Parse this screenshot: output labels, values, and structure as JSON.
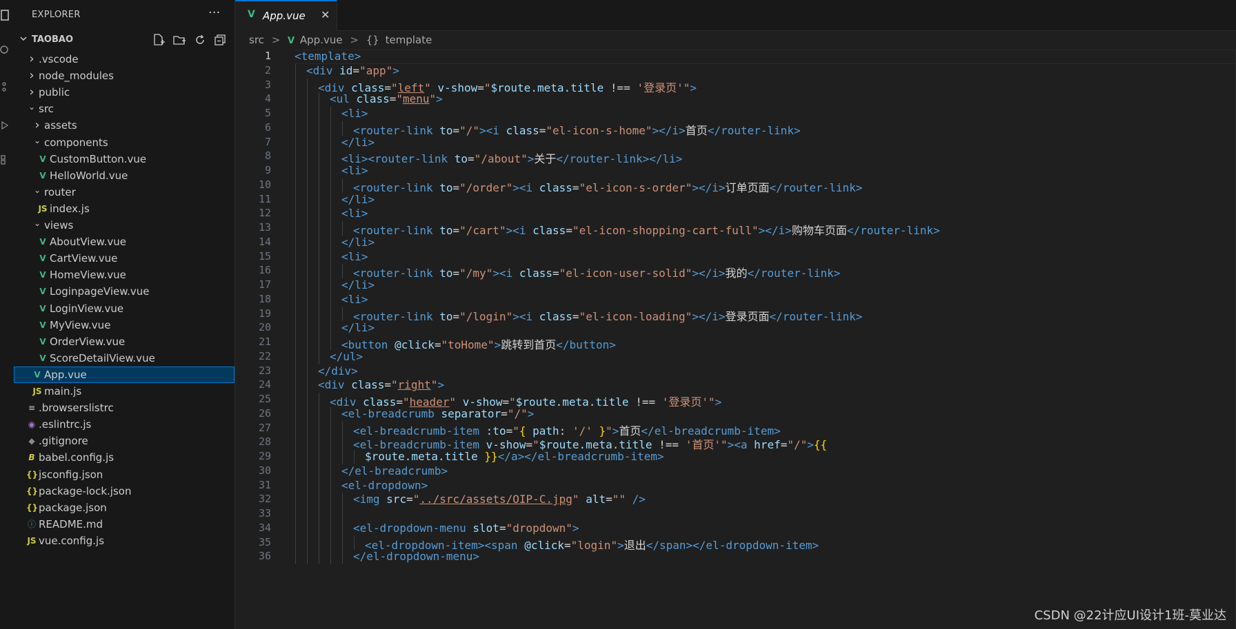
{
  "explorer": {
    "title": "EXPLORER",
    "more": "···",
    "root": "TAOBAO",
    "items": [
      {
        "label": ".vscode",
        "icon": "chevron-right",
        "depth": 1
      },
      {
        "label": "node_modules",
        "icon": "chevron-right",
        "depth": 1
      },
      {
        "label": "public",
        "icon": "chevron-right",
        "depth": 1
      },
      {
        "label": "src",
        "icon": "chevron-down",
        "depth": 1
      },
      {
        "label": "assets",
        "icon": "chevron-right",
        "depth": 2
      },
      {
        "label": "components",
        "icon": "chevron-down",
        "depth": 2
      },
      {
        "label": "CustomButton.vue",
        "icon": "vue",
        "depth": 3
      },
      {
        "label": "HelloWorld.vue",
        "icon": "vue",
        "depth": 3
      },
      {
        "label": "router",
        "icon": "chevron-down",
        "depth": 2
      },
      {
        "label": "index.js",
        "icon": "js",
        "depth": 3
      },
      {
        "label": "views",
        "icon": "chevron-down",
        "depth": 2
      },
      {
        "label": "AboutView.vue",
        "icon": "vue",
        "depth": 3
      },
      {
        "label": "CartView.vue",
        "icon": "vue",
        "depth": 3
      },
      {
        "label": "HomeView.vue",
        "icon": "vue",
        "depth": 3
      },
      {
        "label": "LoginpageView.vue",
        "icon": "vue",
        "depth": 3
      },
      {
        "label": "LoginView.vue",
        "icon": "vue",
        "depth": 3
      },
      {
        "label": "MyView.vue",
        "icon": "vue",
        "depth": 3
      },
      {
        "label": "OrderView.vue",
        "icon": "vue",
        "depth": 3
      },
      {
        "label": "ScoreDetailView.vue",
        "icon": "vue",
        "depth": 3
      },
      {
        "label": "App.vue",
        "icon": "vue",
        "depth": 2,
        "selected": true
      },
      {
        "label": "main.js",
        "icon": "js",
        "depth": 2
      },
      {
        "label": ".browserslistrc",
        "icon": "lines",
        "depth": 1
      },
      {
        "label": ".eslintrc.js",
        "icon": "eslint",
        "depth": 1
      },
      {
        "label": ".gitignore",
        "icon": "git",
        "depth": 1
      },
      {
        "label": "babel.config.js",
        "icon": "babel",
        "depth": 1
      },
      {
        "label": "jsconfig.json",
        "icon": "json",
        "depth": 1
      },
      {
        "label": "package-lock.json",
        "icon": "json",
        "depth": 1
      },
      {
        "label": "package.json",
        "icon": "json",
        "depth": 1
      },
      {
        "label": "README.md",
        "icon": "info",
        "depth": 1
      },
      {
        "label": "vue.config.js",
        "icon": "js",
        "depth": 1
      }
    ]
  },
  "tab": {
    "label": "App.vue",
    "close": "✕"
  },
  "breadcrumb": {
    "part1": "src",
    "sep": ">",
    "part2": "App.vue",
    "part3_icon": "{}",
    "part3": "template"
  },
  "active_line": 1,
  "code_lines": [
    [
      [
        "t",
        "<template>"
      ]
    ],
    [
      [
        "t",
        "<div"
      ],
      [
        "",
        " "
      ],
      [
        "a",
        "id"
      ],
      [
        "",
        "="
      ],
      [
        "s",
        "\"app\""
      ],
      [
        "t",
        ">"
      ]
    ],
    [
      [
        "t",
        "<div"
      ],
      [
        "",
        " "
      ],
      [
        "a",
        "class"
      ],
      [
        "",
        "="
      ],
      [
        "s",
        "\""
      ],
      [
        "su",
        "left"
      ],
      [
        "s",
        "\""
      ],
      [
        "",
        " "
      ],
      [
        "a",
        "v-show"
      ],
      [
        "",
        "="
      ],
      [
        "s",
        "\""
      ],
      [
        "a",
        "$route.meta.title"
      ],
      [
        "",
        " "
      ],
      [
        "",
        "!=="
      ],
      [
        "",
        " "
      ],
      [
        "s",
        "'登录页'"
      ],
      [
        "s",
        "\""
      ],
      [
        "t",
        ">"
      ]
    ],
    [
      [
        "t",
        "<ul"
      ],
      [
        "",
        " "
      ],
      [
        "a",
        "class"
      ],
      [
        "",
        "="
      ],
      [
        "s",
        "\""
      ],
      [
        "su",
        "menu"
      ],
      [
        "s",
        "\""
      ],
      [
        "t",
        ">"
      ]
    ],
    [
      [
        "t",
        "<li>"
      ]
    ],
    [
      [
        "t",
        "<router-link"
      ],
      [
        "",
        " "
      ],
      [
        "a",
        "to"
      ],
      [
        "",
        "="
      ],
      [
        "s",
        "\"/\""
      ],
      [
        "t",
        "><i"
      ],
      [
        "",
        " "
      ],
      [
        "a",
        "class"
      ],
      [
        "",
        "="
      ],
      [
        "s",
        "\"el-icon-s-home\""
      ],
      [
        "t",
        "></i>"
      ],
      [
        "",
        "首页"
      ],
      [
        "t",
        "</router-link>"
      ]
    ],
    [
      [
        "t",
        "</li>"
      ]
    ],
    [
      [
        "t",
        "<li><router-link"
      ],
      [
        "",
        " "
      ],
      [
        "a",
        "to"
      ],
      [
        "",
        "="
      ],
      [
        "s",
        "\"/about\""
      ],
      [
        "t",
        ">"
      ],
      [
        "",
        "关于"
      ],
      [
        "t",
        "</router-link></li>"
      ]
    ],
    [
      [
        "t",
        "<li>"
      ]
    ],
    [
      [
        "t",
        "<router-link"
      ],
      [
        "",
        " "
      ],
      [
        "a",
        "to"
      ],
      [
        "",
        "="
      ],
      [
        "s",
        "\"/order\""
      ],
      [
        "t",
        "><i"
      ],
      [
        "",
        " "
      ],
      [
        "a",
        "class"
      ],
      [
        "",
        "="
      ],
      [
        "s",
        "\"el-icon-s-order\""
      ],
      [
        "t",
        "></i>"
      ],
      [
        "",
        "订单页面"
      ],
      [
        "t",
        "</router-link>"
      ]
    ],
    [
      [
        "t",
        "</li>"
      ]
    ],
    [
      [
        "t",
        "<li>"
      ]
    ],
    [
      [
        "t",
        "<router-link"
      ],
      [
        "",
        " "
      ],
      [
        "a",
        "to"
      ],
      [
        "",
        "="
      ],
      [
        "s",
        "\"/cart\""
      ],
      [
        "t",
        "><i"
      ],
      [
        "",
        " "
      ],
      [
        "a",
        "class"
      ],
      [
        "",
        "="
      ],
      [
        "s",
        "\"el-icon-shopping-cart-full\""
      ],
      [
        "t",
        "></i>"
      ],
      [
        "",
        "购物车页面"
      ],
      [
        "t",
        "</router-link>"
      ]
    ],
    [
      [
        "t",
        "</li>"
      ]
    ],
    [
      [
        "t",
        "<li>"
      ]
    ],
    [
      [
        "t",
        "<router-link"
      ],
      [
        "",
        " "
      ],
      [
        "a",
        "to"
      ],
      [
        "",
        "="
      ],
      [
        "s",
        "\"/my\""
      ],
      [
        "t",
        "><i"
      ],
      [
        "",
        " "
      ],
      [
        "a",
        "class"
      ],
      [
        "",
        "="
      ],
      [
        "s",
        "\"el-icon-user-solid\""
      ],
      [
        "t",
        "></i>"
      ],
      [
        "",
        "我的"
      ],
      [
        "t",
        "</router-link>"
      ]
    ],
    [
      [
        "t",
        "</li>"
      ]
    ],
    [
      [
        "t",
        "<li>"
      ]
    ],
    [
      [
        "t",
        "<router-link"
      ],
      [
        "",
        " "
      ],
      [
        "a",
        "to"
      ],
      [
        "",
        "="
      ],
      [
        "s",
        "\"/login\""
      ],
      [
        "t",
        "><i"
      ],
      [
        "",
        " "
      ],
      [
        "a",
        "class"
      ],
      [
        "",
        "="
      ],
      [
        "s",
        "\"el-icon-loading\""
      ],
      [
        "t",
        "></i>"
      ],
      [
        "",
        "登录页面"
      ],
      [
        "t",
        "</router-link>"
      ]
    ],
    [
      [
        "t",
        "</li>"
      ]
    ],
    [
      [
        "t",
        "<button"
      ],
      [
        "",
        " "
      ],
      [
        "a",
        "@click"
      ],
      [
        "",
        "="
      ],
      [
        "s",
        "\"toHome\""
      ],
      [
        "t",
        ">"
      ],
      [
        "",
        "跳转到首页"
      ],
      [
        "t",
        "</button>"
      ]
    ],
    [
      [
        "t",
        "</ul>"
      ]
    ],
    [
      [
        "t",
        "</div>"
      ]
    ],
    [
      [
        "t",
        "<div"
      ],
      [
        "",
        " "
      ],
      [
        "a",
        "class"
      ],
      [
        "",
        "="
      ],
      [
        "s",
        "\""
      ],
      [
        "su",
        "right"
      ],
      [
        "s",
        "\""
      ],
      [
        "t",
        ">"
      ]
    ],
    [
      [
        "t",
        "<div"
      ],
      [
        "",
        " "
      ],
      [
        "a",
        "class"
      ],
      [
        "",
        "="
      ],
      [
        "s",
        "\""
      ],
      [
        "su",
        "header"
      ],
      [
        "s",
        "\""
      ],
      [
        "",
        " "
      ],
      [
        "a",
        "v-show"
      ],
      [
        "",
        "="
      ],
      [
        "s",
        "\""
      ],
      [
        "a",
        "$route.meta.title"
      ],
      [
        "",
        " "
      ],
      [
        "",
        "!=="
      ],
      [
        "",
        " "
      ],
      [
        "s",
        "'登录页'"
      ],
      [
        "s",
        "\""
      ],
      [
        "t",
        ">"
      ]
    ],
    [
      [
        "t",
        "<el-breadcrumb"
      ],
      [
        "",
        " "
      ],
      [
        "a",
        "separator"
      ],
      [
        "",
        "="
      ],
      [
        "s",
        "\"/\""
      ],
      [
        "t",
        ">"
      ]
    ],
    [
      [
        "t",
        "<el-breadcrumb-item"
      ],
      [
        "",
        " "
      ],
      [
        "a",
        ":to"
      ],
      [
        "",
        "="
      ],
      [
        "s",
        "\""
      ],
      [
        "y",
        "{"
      ],
      [
        "",
        " "
      ],
      [
        "a",
        "path"
      ],
      [
        "",
        ": "
      ],
      [
        "s",
        "'/'"
      ],
      [
        "",
        " "
      ],
      [
        "y",
        "}"
      ],
      [
        "s",
        "\""
      ],
      [
        "t",
        ">"
      ],
      [
        "",
        "首页"
      ],
      [
        "t",
        "</el-breadcrumb-item>"
      ]
    ],
    [
      [
        "t",
        "<el-breadcrumb-item"
      ],
      [
        "",
        " "
      ],
      [
        "a",
        "v-show"
      ],
      [
        "",
        "="
      ],
      [
        "s",
        "\""
      ],
      [
        "a",
        "$route.meta.title"
      ],
      [
        "",
        " "
      ],
      [
        "",
        "!=="
      ],
      [
        "",
        " "
      ],
      [
        "s",
        "'首页'"
      ],
      [
        "s",
        "\""
      ],
      [
        "t",
        "><a"
      ],
      [
        "",
        " "
      ],
      [
        "a",
        "href"
      ],
      [
        "",
        "="
      ],
      [
        "s",
        "\"/\""
      ],
      [
        "t",
        ">"
      ],
      [
        "y",
        "{{"
      ]
    ],
    [
      [
        "a",
        "$route.meta.title"
      ],
      [
        "",
        " "
      ],
      [
        "y",
        "}}"
      ],
      [
        "t",
        "</a></el-breadcrumb-item>"
      ]
    ],
    [
      [
        "t",
        "</el-breadcrumb>"
      ]
    ],
    [
      [
        "t",
        "<el-dropdown>"
      ]
    ],
    [
      [
        "t",
        "<img"
      ],
      [
        "",
        " "
      ],
      [
        "a",
        "src"
      ],
      [
        "",
        "="
      ],
      [
        "s",
        "\""
      ],
      [
        "su",
        "../src/assets/OIP-C.jpg"
      ],
      [
        "s",
        "\""
      ],
      [
        "",
        " "
      ],
      [
        "a",
        "alt"
      ],
      [
        "",
        "="
      ],
      [
        "s",
        "\"\""
      ],
      [
        "",
        " "
      ],
      [
        "t",
        "/>"
      ]
    ],
    [],
    [
      [
        "t",
        "<el-dropdown-menu"
      ],
      [
        "",
        " "
      ],
      [
        "a",
        "slot"
      ],
      [
        "",
        "="
      ],
      [
        "s",
        "\"dropdown\""
      ],
      [
        "t",
        ">"
      ]
    ],
    [
      [
        "t",
        "<el-dropdown-item><span"
      ],
      [
        "",
        " "
      ],
      [
        "a",
        "@click"
      ],
      [
        "",
        "="
      ],
      [
        "s",
        "\"login\""
      ],
      [
        "t",
        ">"
      ],
      [
        "",
        "退出"
      ],
      [
        "t",
        "</span></el-dropdown-item>"
      ]
    ],
    [
      [
        "t",
        "</el-dropdown-menu>"
      ]
    ]
  ],
  "code_indents": [
    0,
    1,
    2,
    3,
    4,
    5,
    4,
    4,
    4,
    5,
    4,
    4,
    5,
    4,
    4,
    5,
    4,
    4,
    5,
    4,
    4,
    3,
    2,
    2,
    3,
    4,
    5,
    5,
    6,
    4,
    4,
    5,
    5,
    5,
    6,
    5
  ],
  "watermark": "CSDN @22计应UI设计1班-莫业达",
  "colors": {
    "accent": "#0078d4",
    "vue": "#41b883",
    "tag": "#569cd6",
    "attr": "#9cdcfe",
    "string": "#ce9178"
  }
}
